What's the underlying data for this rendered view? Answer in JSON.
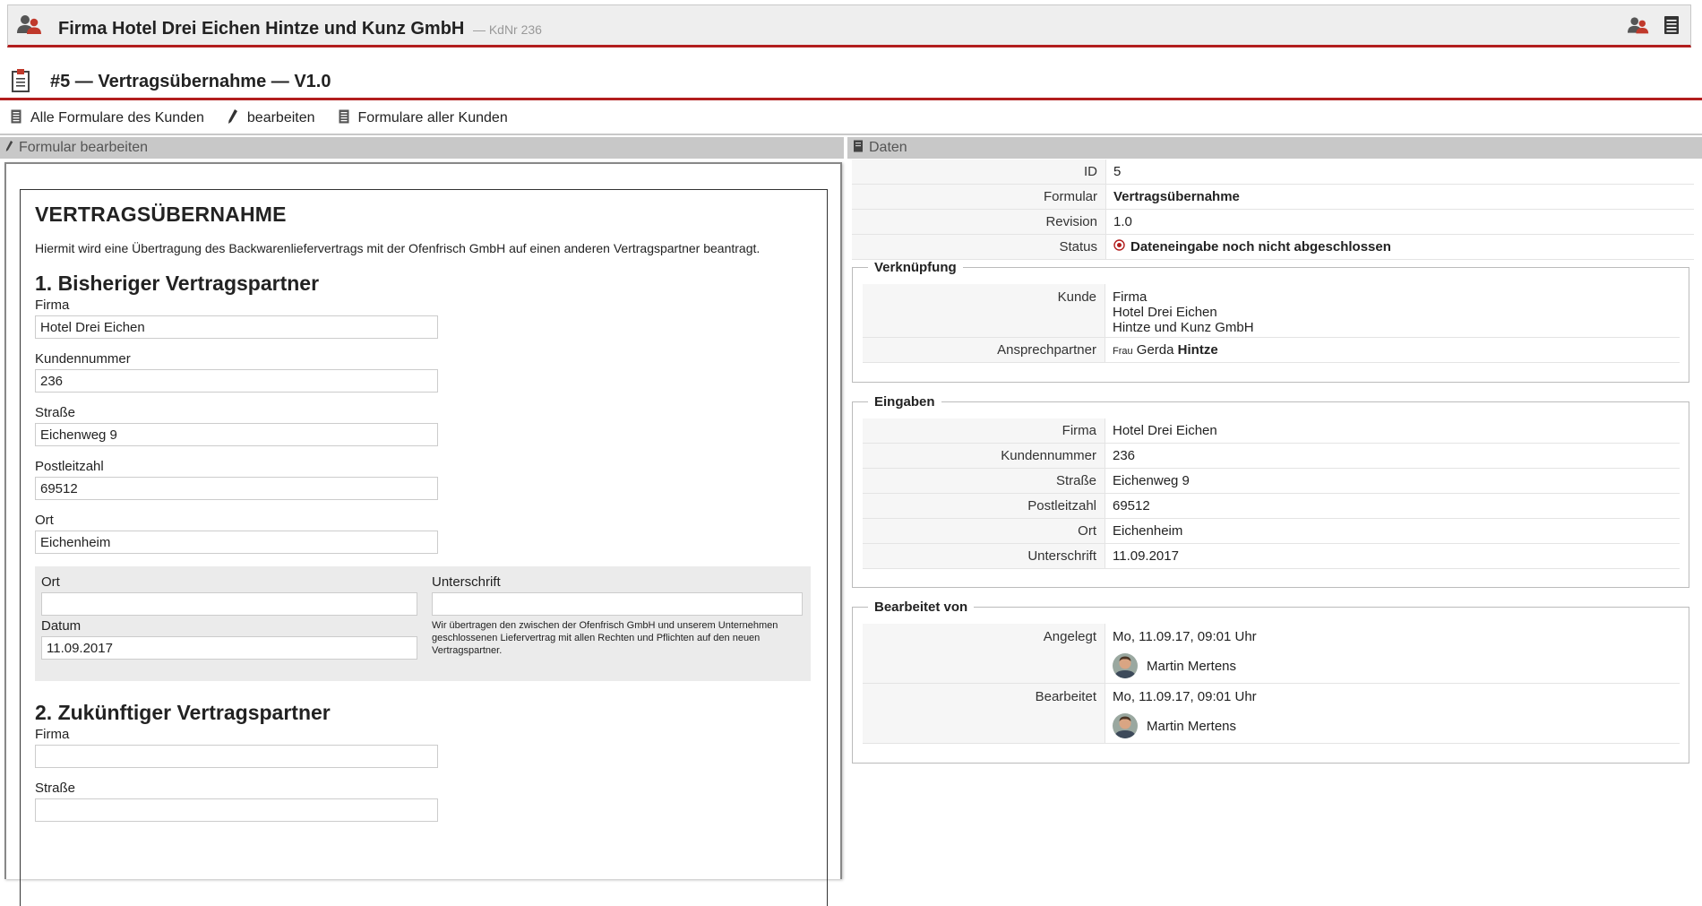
{
  "customer_header": {
    "title": "Firma Hotel Drei Eichen Hintze und Kunz GmbH",
    "kdnr": "— KdNr 236",
    "icons": [
      "people-icon",
      "contacts-icon",
      "document-list-icon"
    ]
  },
  "form_header": {
    "title": "#5 — Vertragsübernahme — V1.0",
    "icon": "clipboard-icon"
  },
  "toolbar": {
    "all_forms_customer": "Alle Formulare des Kunden",
    "edit": "bearbeiten",
    "forms_all_customers": "Formulare aller Kunden"
  },
  "left_panel": {
    "header": "Formular bearbeiten"
  },
  "right_panel": {
    "header": "Daten"
  },
  "form": {
    "title": "VERTRAGSÜBERNAHME",
    "intro": "Hiermit wird eine Übertragung des Backwarenliefervertrags mit der Ofenfrisch GmbH auf einen anderen Vertragspartner beantragt.",
    "section1": {
      "title": "1. Bisheriger Vertragspartner",
      "fields": [
        {
          "label": "Firma",
          "value": "Hotel Drei Eichen"
        },
        {
          "label": "Kundennummer",
          "value": "236"
        },
        {
          "label": "Straße",
          "value": "Eichenweg 9"
        },
        {
          "label": "Postleitzahl",
          "value": "69512"
        },
        {
          "label": "Ort",
          "value": "Eichenheim"
        }
      ]
    },
    "signature": {
      "ort_label": "Ort",
      "ort_value": "",
      "datum_label": "Datum",
      "datum_value": "11.09.2017",
      "unterschrift_label": "Unterschrift",
      "unterschrift_value": "",
      "note": "Wir übertragen den zwischen der Ofenfrisch GmbH und unserem Unternehmen geschlossenen Liefervertrag mit allen Rechten und Pflichten auf den neuen Vertragspartner."
    },
    "section2": {
      "title": "2. Zukünftiger Vertragspartner",
      "fields": [
        {
          "label": "Firma",
          "value": ""
        },
        {
          "label": "Straße",
          "value": ""
        }
      ]
    }
  },
  "data": {
    "id_label": "ID",
    "id": "5",
    "formular_label": "Formular",
    "formular": "Vertragsübernahme",
    "revision_label": "Revision",
    "revision": "1.0",
    "status_label": "Status",
    "status": "Dateneingabe noch nicht abgeschlossen"
  },
  "verknuepfung": {
    "legend": "Verknüpfung",
    "kunde_label": "Kunde",
    "kunde_lines": [
      "Firma",
      "Hotel Drei Eichen",
      "Hintze und Kunz GmbH"
    ],
    "ansprechpartner_label": "Ansprechpartner",
    "anrede": "Frau",
    "vorname": "Gerda",
    "nachname": "Hintze"
  },
  "eingaben": {
    "legend": "Eingaben",
    "rows": [
      {
        "label": "Firma",
        "value": "Hotel Drei Eichen"
      },
      {
        "label": "Kundennummer",
        "value": "236"
      },
      {
        "label": "Straße",
        "value": "Eichenweg 9"
      },
      {
        "label": "Postleitzahl",
        "value": "69512"
      },
      {
        "label": "Ort",
        "value": "Eichenheim"
      },
      {
        "label": "Unterschrift",
        "value": "11.09.2017"
      }
    ]
  },
  "bearbeitet_von": {
    "legend": "Bearbeitet von",
    "rows": [
      {
        "label": "Angelegt",
        "date": "Mo, 11.09.17, 09:01 Uhr",
        "user": "Martin Mertens"
      },
      {
        "label": "Bearbeitet",
        "date": "Mo, 11.09.17, 09:01 Uhr",
        "user": "Martin Mertens"
      }
    ]
  },
  "colors": {
    "accent": "#b21e1e",
    "panel_header": "#c8c8c8"
  }
}
